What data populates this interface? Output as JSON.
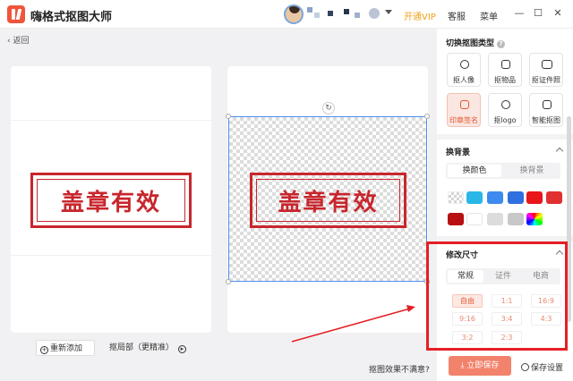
{
  "app": {
    "title": "嗨格式抠图大师"
  },
  "header": {
    "vip_label": "开通VIP",
    "service_label": "客服",
    "menu_label": "菜单"
  },
  "nav": {
    "back_label": "返回"
  },
  "stamp": {
    "text": "盖章有效",
    "color": "#c8262d"
  },
  "canvas": {
    "add_button": "重新添加",
    "local_button": "抠局部（更精准）",
    "feedback": "抠图效果不满意?"
  },
  "sidebar": {
    "type_section": {
      "title": "切换抠图类型",
      "items": [
        {
          "label": "抠人像",
          "icon": "person-icon"
        },
        {
          "label": "抠物品",
          "icon": "bag-icon"
        },
        {
          "label": "抠证件照",
          "icon": "id-card-icon"
        },
        {
          "label": "印章签名",
          "icon": "seal-icon",
          "active": true
        },
        {
          "label": "抠logo",
          "icon": "badge-icon"
        },
        {
          "label": "智能抠图",
          "icon": "ai-icon"
        }
      ]
    },
    "background_section": {
      "title": "换背景",
      "tabs": [
        {
          "label": "换颜色",
          "active": true
        },
        {
          "label": "换背景"
        }
      ],
      "swatches": [
        "transparent",
        "#2ab7e8",
        "#3d8af0",
        "#2f6fe0",
        "#e8151b",
        "#e03030",
        "#b80f12",
        "#ffffff",
        "#dcdcdc",
        "#c8c8c8",
        "gradient"
      ]
    },
    "size_section": {
      "title": "修改尺寸",
      "tabs": [
        {
          "label": "常规",
          "active": true
        },
        {
          "label": "证件"
        },
        {
          "label": "电商"
        }
      ],
      "ratios": [
        "自由",
        "1:1",
        "16:9",
        "9:16",
        "3:4",
        "4:3",
        "3:2",
        "2:3"
      ]
    },
    "save_button": "立即保存",
    "save_settings": "保存设置"
  },
  "colors": {
    "accent": "#f2826b",
    "highlight": "#e41f25",
    "vip": "#f0a21b"
  }
}
